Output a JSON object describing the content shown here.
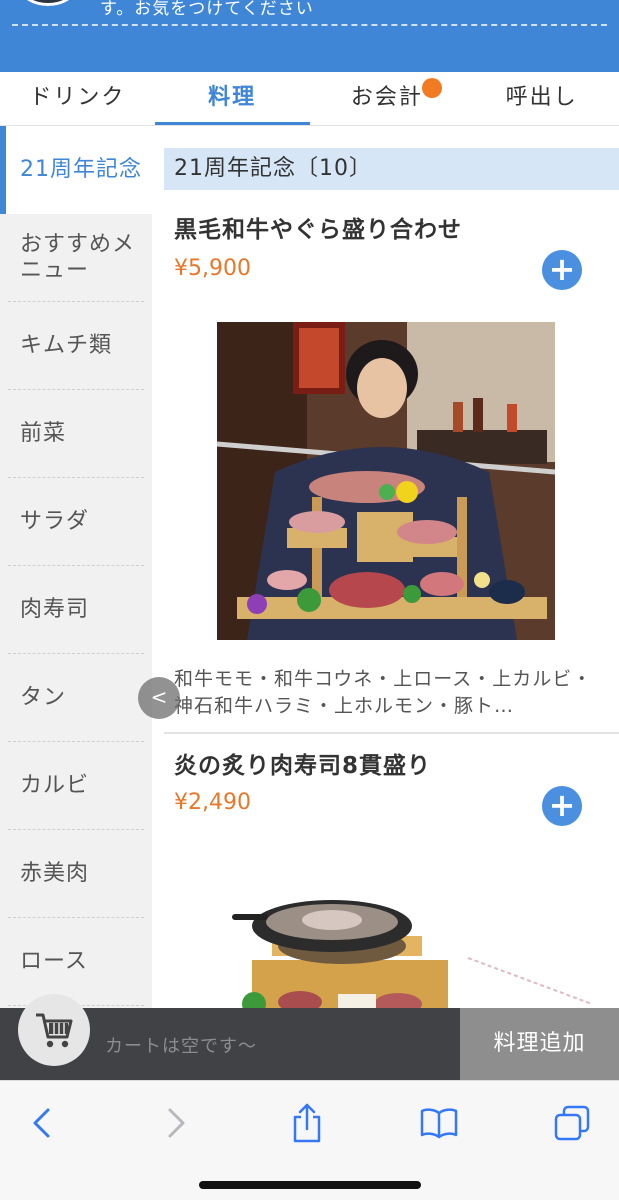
{
  "header": {
    "notice": "す。お気をつけてください"
  },
  "tabs": [
    {
      "label": "ドリンク",
      "active": false
    },
    {
      "label": "料理",
      "active": true
    },
    {
      "label": "お会計",
      "active": false,
      "has_badge": true
    },
    {
      "label": "呼出し",
      "active": false
    }
  ],
  "sidebar": {
    "items": [
      {
        "label": "21周年記念",
        "active": true
      },
      {
        "label": "おすすめメニュー"
      },
      {
        "label": "キムチ類"
      },
      {
        "label": "前菜"
      },
      {
        "label": "サラダ"
      },
      {
        "label": "肉寿司"
      },
      {
        "label": "タン"
      },
      {
        "label": "カルビ"
      },
      {
        "label": "赤美肉"
      },
      {
        "label": "ロース"
      }
    ]
  },
  "main": {
    "category_header": "21周年記念〔10〕",
    "items": [
      {
        "name": "黒毛和牛やぐら盛り合わせ",
        "price": "¥5,900",
        "description": "和牛モモ・和牛コウネ・上ロース・上カルビ・神石和牛ハラミ・上ホルモン・豚ト…"
      },
      {
        "name": "炎の炙り肉寿司8貫盛り",
        "price": "¥2,490"
      }
    ],
    "add_symbol": "+",
    "collapse_symbol": "<"
  },
  "cart": {
    "empty_text": "カートは空です〜",
    "add_button": "料理追加"
  },
  "colors": {
    "primary": "#3f86d6",
    "price": "#e8772a",
    "badge": "#f07b22",
    "cart_bar": "#404246"
  },
  "icons": {
    "cart": "cart-icon",
    "back": "chevron-left-icon",
    "forward": "chevron-right-icon",
    "share": "share-icon",
    "bookmarks": "book-icon",
    "tabs": "tabs-icon"
  }
}
